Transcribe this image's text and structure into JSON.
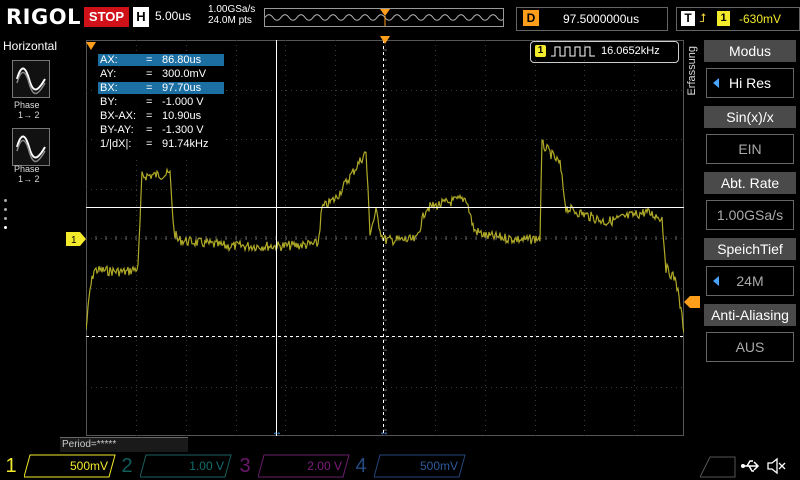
{
  "header": {
    "brand": "RIGOL",
    "run_state": "STOP",
    "timebase_letter": "H",
    "timebase_value": "5.00us",
    "sample_rate": "1.00GSa/s",
    "memory_points": "24.0M pts",
    "delay_letter": "D",
    "delay_value": "97.5000000us",
    "trigger_letter": "T",
    "trigger_channel": "1",
    "trigger_level": "-630mV"
  },
  "left_panel": {
    "title": "Horizontal",
    "phase1_label": "Phase",
    "phase1_sub": "1→ 2",
    "phase2_label": "Phase",
    "phase2_sub": "1→ 2"
  },
  "cursor_readout": {
    "rows": [
      {
        "key": "AX:",
        "value": "86.80us"
      },
      {
        "key": "AY:",
        "value": "300.0mV"
      },
      {
        "key": "BX:",
        "value": "97.70us"
      },
      {
        "key": "BY:",
        "value": "-1.000 V"
      },
      {
        "key": "BX-AX:",
        "value": "10.90us"
      },
      {
        "key": "BY-AY:",
        "value": "-1.300 V"
      },
      {
        "key": "1/|dX|:",
        "value": "91.74kHz"
      }
    ],
    "equals": "="
  },
  "frequency": {
    "channel": "1",
    "value": "16.0652kHz"
  },
  "right_menu": {
    "side_label": "Erfassung",
    "items": [
      {
        "title": "Modus",
        "value": "Hi Res"
      },
      {
        "title": "Sin(x)/x",
        "value": "EIN"
      },
      {
        "title": "Abt. Rate",
        "value": "1.00GSa/s"
      },
      {
        "title": "SpeichTief",
        "value": "24M"
      },
      {
        "title": "Anti-Aliasing",
        "value": "AUS"
      }
    ]
  },
  "measurement_bar": {
    "period_label": "Period=*****"
  },
  "channels": [
    {
      "num": "1",
      "scale": "500mV",
      "color": "#f3ea2b"
    },
    {
      "num": "2",
      "scale": "1.00 V",
      "color": "#1fb8b8"
    },
    {
      "num": "3",
      "scale": "2.00 V",
      "color": "#d12fd1"
    },
    {
      "num": "4",
      "scale": "500mV",
      "color": "#3f7fdb"
    }
  ],
  "colors": {
    "trace": "#b8b22a",
    "grid": "#3a3a3a",
    "cursor": "#ffffff",
    "stop": "#d0111a",
    "delay": "#ff9e1b"
  },
  "icons": [
    "usb-icon",
    "speaker-mute-icon",
    "phase-sine-icon",
    "square-wave-icon"
  ]
}
